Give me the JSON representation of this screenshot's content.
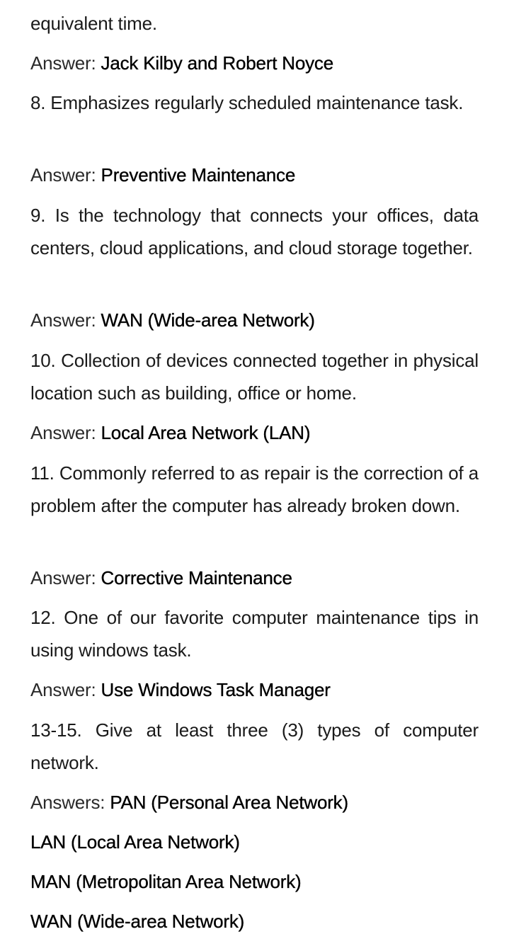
{
  "lines": {
    "intro": "equivalent time.",
    "answer_label": "Answer: ",
    "answers_label": "Answers: "
  },
  "items": [
    {
      "question": null,
      "answer": "Jack Kilby and Robert Noyce"
    },
    {
      "question": "8. Emphasizes regularly scheduled maintenance task.",
      "answer": "Preventive Maintenance"
    },
    {
      "question": "9. Is the technology that connects your offices, data centers, cloud applications, and cloud storage together.",
      "answer": "WAN (Wide-area Network)"
    },
    {
      "question": "10. Collection of devices connected together in physical location such as building, office or home.",
      "answer": "Local Area Network (LAN)"
    },
    {
      "question": "11. Commonly referred to as repair is the correction of a problem after the computer has already broken down.",
      "answer": "Corrective Maintenance"
    },
    {
      "question": "12. One of our favorite computer maintenance tips in using windows task.",
      "answer": "Use Windows Task Manager"
    },
    {
      "question": "13-15. Give at least three (3) types of computer network.",
      "answers": [
        "PAN (Personal Area Network)",
        "LAN (Local Area Network)",
        "MAN (Metropolitan Area Network)",
        "WAN (Wide-area Network)"
      ]
    }
  ]
}
